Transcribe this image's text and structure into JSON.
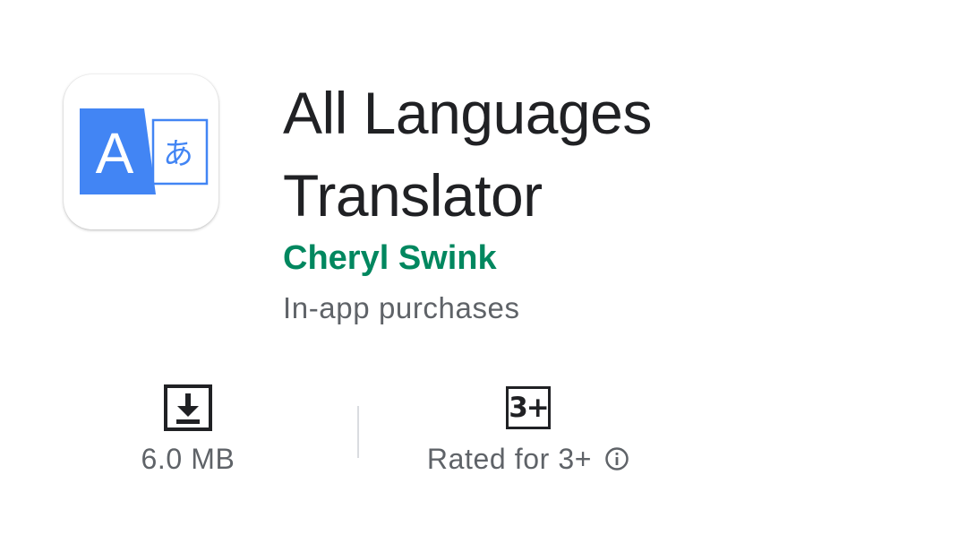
{
  "app": {
    "icon_name": "translate-app-icon",
    "icon_glyph_latin": "A",
    "icon_glyph_kana": "あ",
    "title": "All Languages Translator",
    "developer": "Cheryl Swink",
    "purchases_note": "In-app purchases"
  },
  "stats": {
    "size": {
      "icon": "download-icon",
      "label": "6.0 MB"
    },
    "rating": {
      "badge": "3+",
      "label": "Rated for 3+",
      "info_icon": "info-icon"
    }
  },
  "colors": {
    "developer": "#01875f",
    "title": "#202124",
    "secondary": "#5f6368",
    "icon_blue": "#4285f4"
  }
}
